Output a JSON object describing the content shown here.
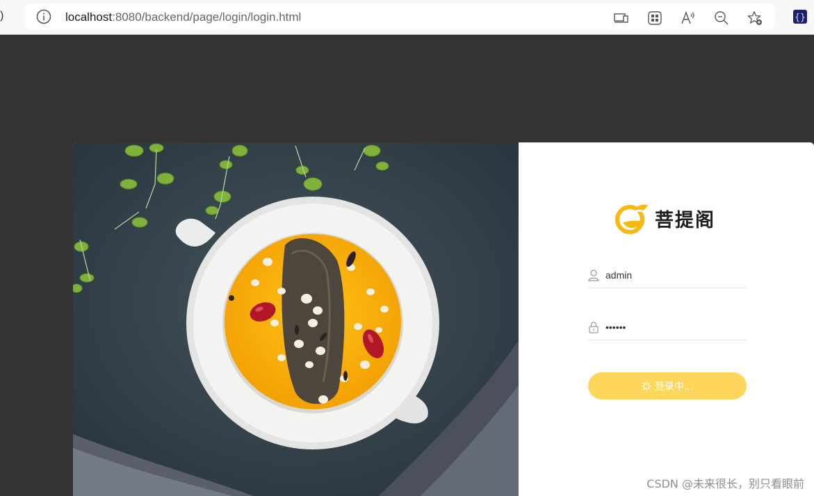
{
  "browser": {
    "url_host": "localhost",
    "url_rest": ":8080/backend/page/login/login.html",
    "edge_glyph": ")",
    "icons": [
      "info-icon",
      "device-icon",
      "qr-icon",
      "read-aloud-icon",
      "zoom-out-icon",
      "favorite-icon",
      "extension-icon"
    ]
  },
  "login": {
    "logo_text": "菩提阁",
    "username_value": "admin",
    "password_value": "••••••",
    "button_label": "登录中...",
    "accent_color": "#ffd65c"
  },
  "watermark": "CSDN @未来很长，别只看眼前"
}
